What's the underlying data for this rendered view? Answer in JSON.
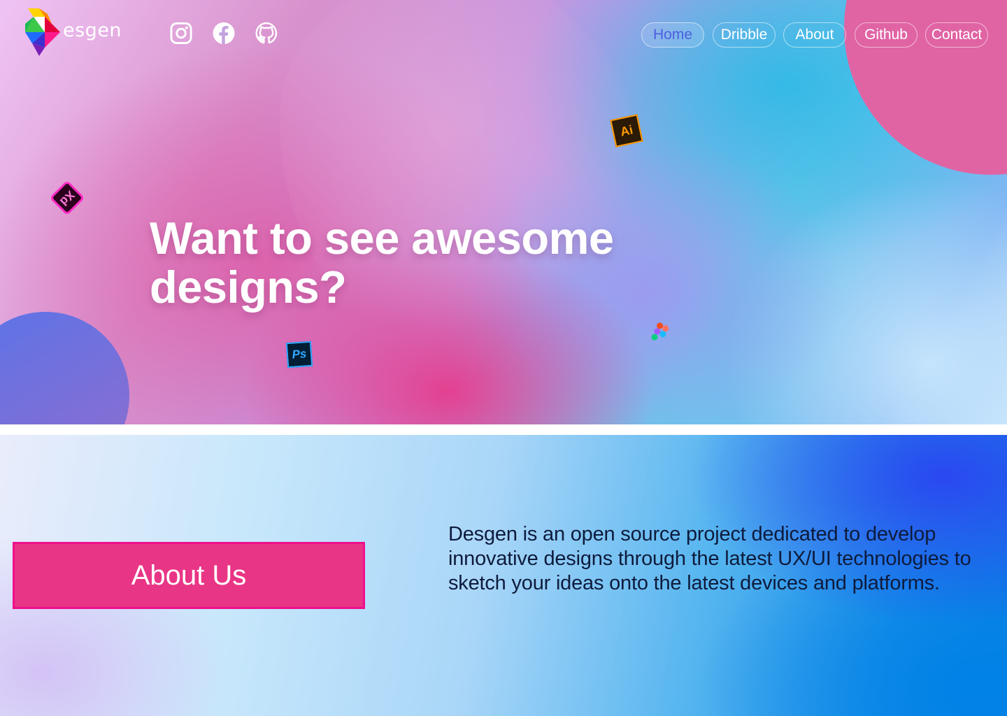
{
  "brand": {
    "logo_text": "esgen",
    "logo_icon": "desgen-logo"
  },
  "social": [
    {
      "name": "instagram-icon"
    },
    {
      "name": "facebook-icon"
    },
    {
      "name": "github-icon"
    }
  ],
  "nav": {
    "items": [
      {
        "label": "Home",
        "active": true
      },
      {
        "label": "Dribble",
        "active": false
      },
      {
        "label": "About",
        "active": false
      },
      {
        "label": "Github",
        "active": false
      },
      {
        "label": "Contact",
        "active": false
      }
    ]
  },
  "hero": {
    "headline": "Want to see awesome designs?",
    "badges": {
      "ai": "Ai",
      "xd": "Xd",
      "ps": "Ps",
      "figma": "figma-icon"
    }
  },
  "about": {
    "button_label": "About Us",
    "description": "Desgen is an open source project dedicated to develop innovative designs through the latest UX/UI technologies to sketch your ideas onto the latest devices and platforms."
  },
  "colors": {
    "accent_pink": "#e93585",
    "nav_active_text": "#4c5fe0",
    "hero_circle_pink": "#e064a4",
    "about_text": "#0e1b3c"
  }
}
